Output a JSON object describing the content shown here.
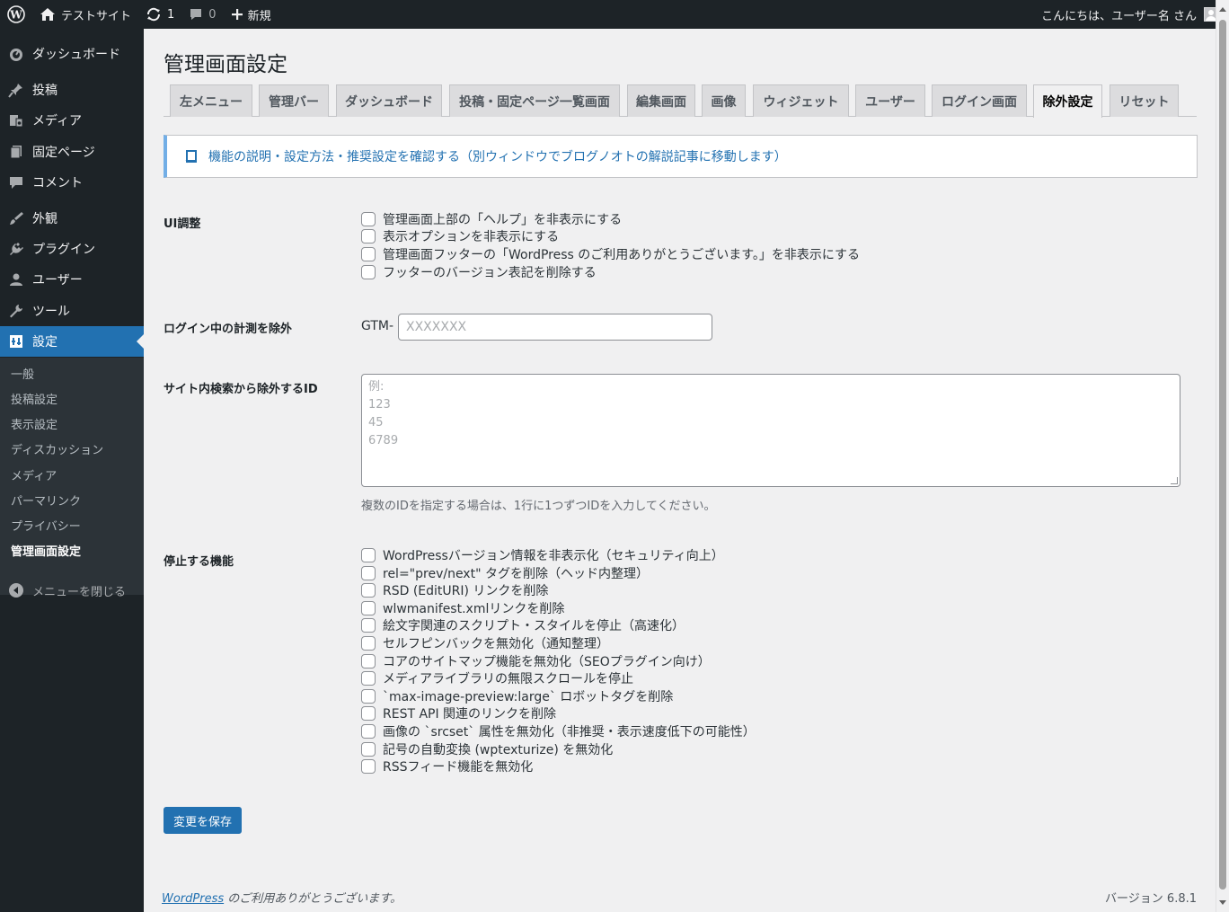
{
  "adminbar": {
    "site_name": "テストサイト",
    "updates_count": "1",
    "comments_count": "0",
    "new_label": "新規",
    "greeting": "こんにちは、ユーザー名 さん"
  },
  "sidebar": {
    "items": [
      {
        "label": "ダッシュボード",
        "icon": "dashboard-icon"
      },
      {
        "label": "投稿",
        "icon": "pin-icon"
      },
      {
        "label": "メディア",
        "icon": "media-icon"
      },
      {
        "label": "固定ページ",
        "icon": "page-icon"
      },
      {
        "label": "コメント",
        "icon": "comment-icon"
      },
      {
        "label": "外観",
        "icon": "brush-icon"
      },
      {
        "label": "プラグイン",
        "icon": "plugin-icon"
      },
      {
        "label": "ユーザー",
        "icon": "user-icon"
      },
      {
        "label": "ツール",
        "icon": "wrench-icon"
      },
      {
        "label": "設定",
        "icon": "settings-icon"
      }
    ],
    "submenu": [
      "一般",
      "投稿設定",
      "表示設定",
      "ディスカッション",
      "メディア",
      "パーマリンク",
      "プライバシー",
      "管理画面設定"
    ],
    "collapse_label": "メニューを閉じる"
  },
  "page": {
    "title": "管理画面設定",
    "tabs": [
      "左メニュー",
      "管理バー",
      "ダッシュボード",
      "投稿・固定ページ一覧画面",
      "編集画面",
      "画像",
      "ウィジェット",
      "ユーザー",
      "ログイン画面",
      "除外設定",
      "リセット"
    ],
    "active_tab": "除外設定",
    "notice_link": "機能の説明・設定方法・推奨設定を確認する（別ウィンドウでブログノオトの解説記事に移動します）"
  },
  "ui_section": {
    "label": "UI調整",
    "options": [
      "管理画面上部の「ヘルプ」を非表示にする",
      "表示オプションを非表示にする",
      "管理画面フッターの「WordPress のご利用ありがとうございます。」を非表示にする",
      "フッターのバージョン表記を削除する"
    ]
  },
  "login_section": {
    "label": "ログイン中の計測を除外",
    "prefix": "GTM-",
    "placeholder": "XXXXXXX",
    "value": ""
  },
  "search_section": {
    "label": "サイト内検索から除外するID",
    "placeholder_lines": [
      "例:",
      "123",
      "45",
      "6789"
    ],
    "description": "複数のIDを指定する場合は、1行に1つずつIDを入力してください。"
  },
  "disable_section": {
    "label": "停止する機能",
    "options": [
      "WordPressバージョン情報を非表示化（セキュリティ向上）",
      "rel=\"prev/next\" タグを削除（ヘッド内整理）",
      "RSD (EditURI) リンクを削除",
      "wlwmanifest.xmlリンクを削除",
      "絵文字関連のスクリプト・スタイルを停止（高速化）",
      "セルフピンバックを無効化（通知整理）",
      "コアのサイトマップ機能を無効化（SEOプラグイン向け）",
      "メディアライブラリの無限スクロールを停止",
      "`max-image-preview:large` ロボットタグを削除",
      "REST API 関連のリンクを削除",
      "画像の `srcset` 属性を無効化（非推奨・表示速度低下の可能性）",
      "記号の自動変換 (wptexturize) を無効化",
      "RSSフィード機能を無効化"
    ]
  },
  "save_label": "変更を保存",
  "footer": {
    "wp_link": "WordPress",
    "thanks": " のご利用ありがとうございます。",
    "version": "バージョン 6.8.1"
  },
  "colors": {
    "adminbar_bg": "#1d2327",
    "accent": "#2271b1"
  }
}
